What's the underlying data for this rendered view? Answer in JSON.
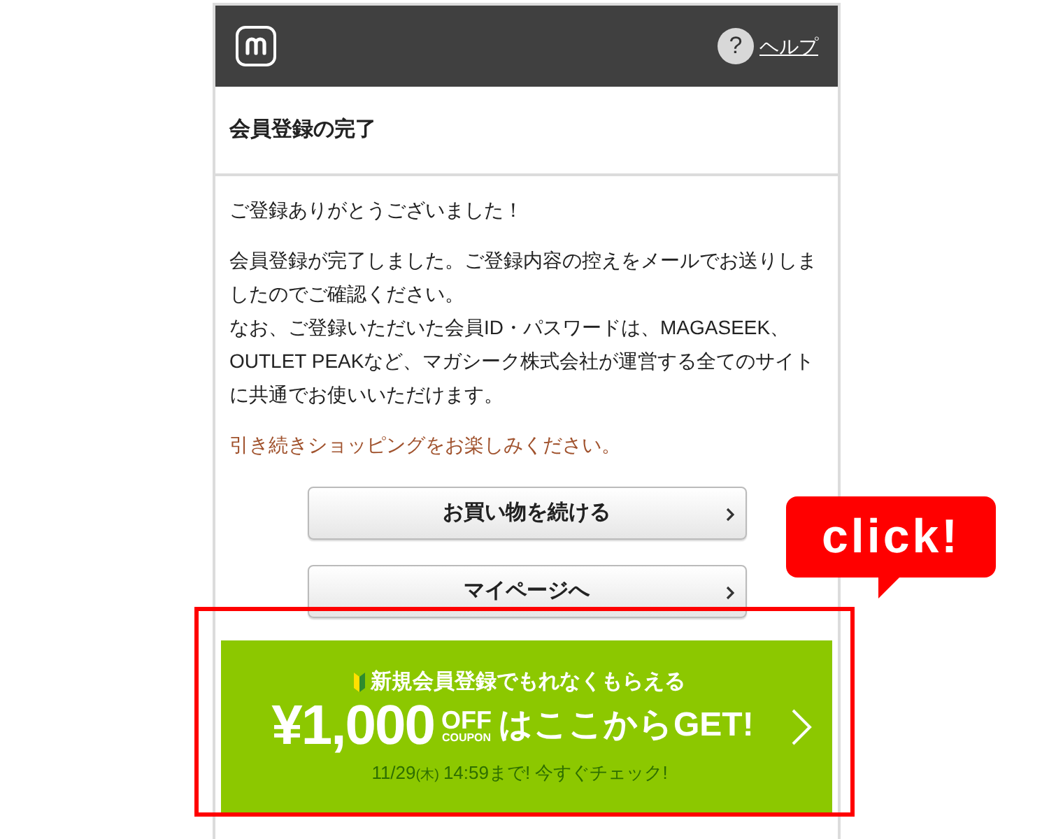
{
  "header": {
    "help_icon": "?",
    "help_link": "ヘルプ"
  },
  "page_title": "会員登録の完了",
  "body": {
    "thanks": "ご登録ありがとうございました！",
    "paragraphs": [
      "会員登録が完了しました。ご登録内容の控えをメールでお送りしましたのでご確認ください。",
      "なお、ご登録いただいた会員ID・パスワードは、MAGASEEK、OUTLET PEAKなど、マガシーク株式会社が運営する全てのサイトに共通でお使いいただけます。"
    ],
    "note": "引き続きショッピングをお楽しみください。"
  },
  "buttons": [
    "お買い物を続ける",
    "マイページへ"
  ],
  "banner": {
    "headline": "新規会員登録でもれなくもらえる",
    "amount": "¥1,000",
    "off": "OFF",
    "coupon": "COUPON",
    "cta": "はここからGET!",
    "date": "11/29",
    "weekday": "(木)",
    "deadline": "14:59まで! 今すぐチェック!"
  },
  "callout": "click!"
}
